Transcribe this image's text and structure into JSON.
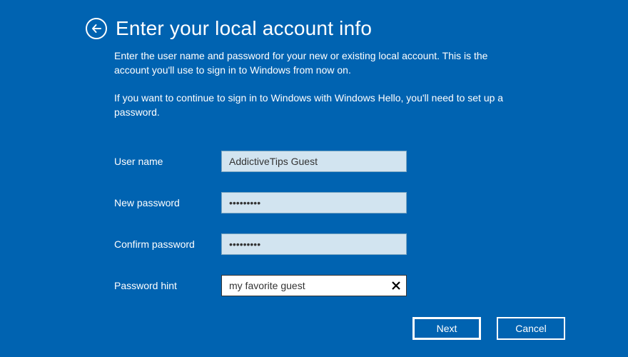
{
  "title": "Enter your local account info",
  "desc1": "Enter the user name and password for your new or existing local account. This is the account you'll use to sign in to Windows from now on.",
  "desc2": "If you want to continue to sign in to Windows with Windows Hello, you'll need to set up a password.",
  "fields": {
    "username": {
      "label": "User name",
      "value": "AddictiveTips Guest"
    },
    "newpassword": {
      "label": "New password",
      "value": "•••••••••"
    },
    "confirmpassword": {
      "label": "Confirm password",
      "value": "•••••••••"
    },
    "hint": {
      "label": "Password hint",
      "value": "my favorite guest"
    }
  },
  "buttons": {
    "next": "Next",
    "cancel": "Cancel"
  }
}
